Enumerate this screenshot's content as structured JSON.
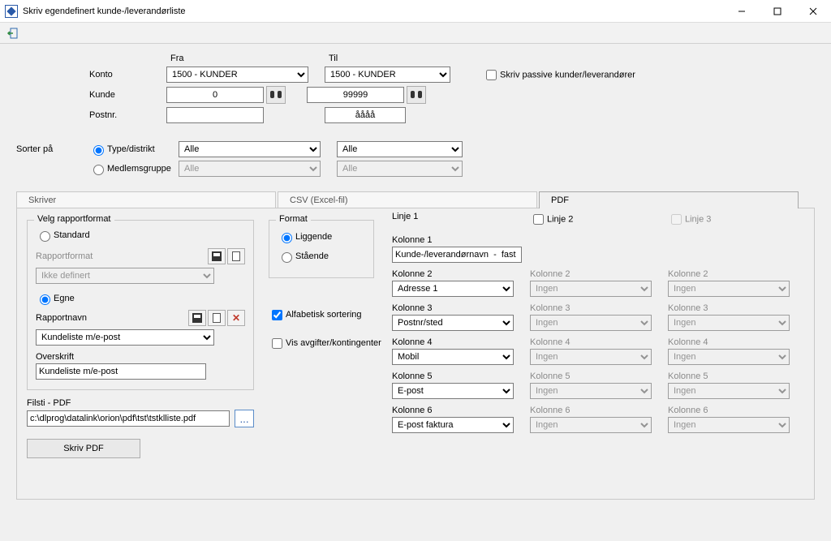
{
  "window": {
    "title": "Skriv egendefinert kunde-/leverandørliste"
  },
  "headers": {
    "fra": "Fra",
    "til": "Til"
  },
  "labels": {
    "konto": "Konto",
    "kunde": "Kunde",
    "postnr": "Postnr.",
    "sorter_pa": "Sorter på",
    "type_distrikt": "Type/distrikt",
    "medlemsgruppe": "Medlemsgruppe",
    "skriv_passive": "Skriv passive kunder/leverandører",
    "skriver": "Skriver",
    "csv": "CSV  (Excel-fil)",
    "pdf": "PDF",
    "velg_rapportformat": "Velg rapportformat",
    "standard": "Standard",
    "rapportformat": "Rapportformat",
    "ikke_definert": "Ikke definert",
    "egne": "Egne",
    "rapportnavn": "Rapportnavn",
    "overskrift": "Overskrift",
    "filsti_pdf": "Filsti - PDF",
    "skriv_pdf": "Skriv PDF",
    "format": "Format",
    "liggende": "Liggende",
    "staende": "Stående",
    "alfabetisk": "Alfabetisk sortering",
    "vis_avgifter": "Vis avgifter/kontingenter",
    "linje1": "Linje 1",
    "linje2": "Linje 2",
    "linje3": "Linje 3",
    "kolonne1": "Kolonne 1",
    "kolonne2": "Kolonne 2",
    "kolonne3": "Kolonne 3",
    "kolonne4": "Kolonne 4",
    "kolonne5": "Kolonne 5",
    "kolonne6": "Kolonne 6"
  },
  "values": {
    "konto_fra": "1500 - KUNDER",
    "konto_til": "1500 - KUNDER",
    "kunde_fra": "0",
    "kunde_til": "99999",
    "postnr_fra": "",
    "postnr_til": "åååå",
    "sort1_fra": "Alle",
    "sort1_til": "Alle",
    "sort2_fra": "Alle",
    "sort2_til": "Alle",
    "rapportnavn_sel": "Kundeliste m/e-post",
    "overskrift_txt": "Kundeliste m/e-post",
    "filsti": "c:\\dlprog\\datalink\\orion\\pdf\\tst\\tstklliste.pdf",
    "k1": "Kunde-/leverandørnavn  -  fast",
    "l1k2": "Adresse 1",
    "l1k3": "Postnr/sted",
    "l1k4": "Mobil",
    "l1k5": "E-post",
    "l1k6": "E-post faktura",
    "ingen": "Ingen"
  },
  "state": {
    "sort_mode": "type",
    "rapport_mode": "egne",
    "orientering": "liggende",
    "alfabetisk_checked": true,
    "vis_avgifter_checked": false,
    "skriv_passive_checked": false,
    "linje2_checked": false,
    "linje3_checked": false
  }
}
